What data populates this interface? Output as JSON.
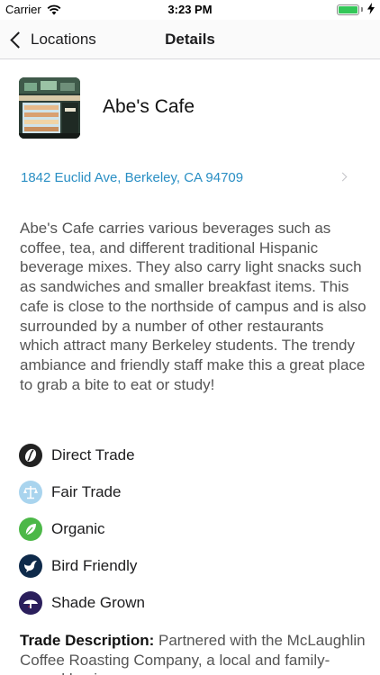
{
  "status_bar": {
    "carrier": "Carrier",
    "time": "3:23 PM"
  },
  "nav": {
    "back_label": "Locations",
    "title": "Details"
  },
  "cafe": {
    "name": "Abe's Cafe",
    "address": "1842 Euclid Ave, Berkeley, CA 94709",
    "description": "Abe's Cafe carries various beverages such as coffee, tea, and different traditional Hispanic beverage mixes. They also carry light snacks such as sandwiches and smaller breakfast items. This cafe is close to the northside of campus and is also surrounded by a number of other restaurants which attract many Berkeley students. The trendy ambiance and friendly staff make this a great place to grab a bite to eat or study!"
  },
  "certifications": [
    {
      "label": "Direct Trade",
      "icon": "coffee-bean-icon",
      "color": "#222222"
    },
    {
      "label": "Fair Trade",
      "icon": "scales-icon",
      "color": "#a9d4ee"
    },
    {
      "label": "Organic",
      "icon": "leaf-icon",
      "color": "#4cb848"
    },
    {
      "label": "Bird Friendly",
      "icon": "bird-icon",
      "color": "#0e2a4a"
    },
    {
      "label": "Shade Grown",
      "icon": "shade-tree-icon",
      "color": "#2b1f5c"
    }
  ],
  "trade_description": {
    "label": "Trade Description:",
    "text": " Partnered with the McLaughlin Coffee Roasting Company, a local and family-owned business"
  },
  "colors": {
    "link": "#2a8fc4",
    "battery": "#34c759"
  }
}
